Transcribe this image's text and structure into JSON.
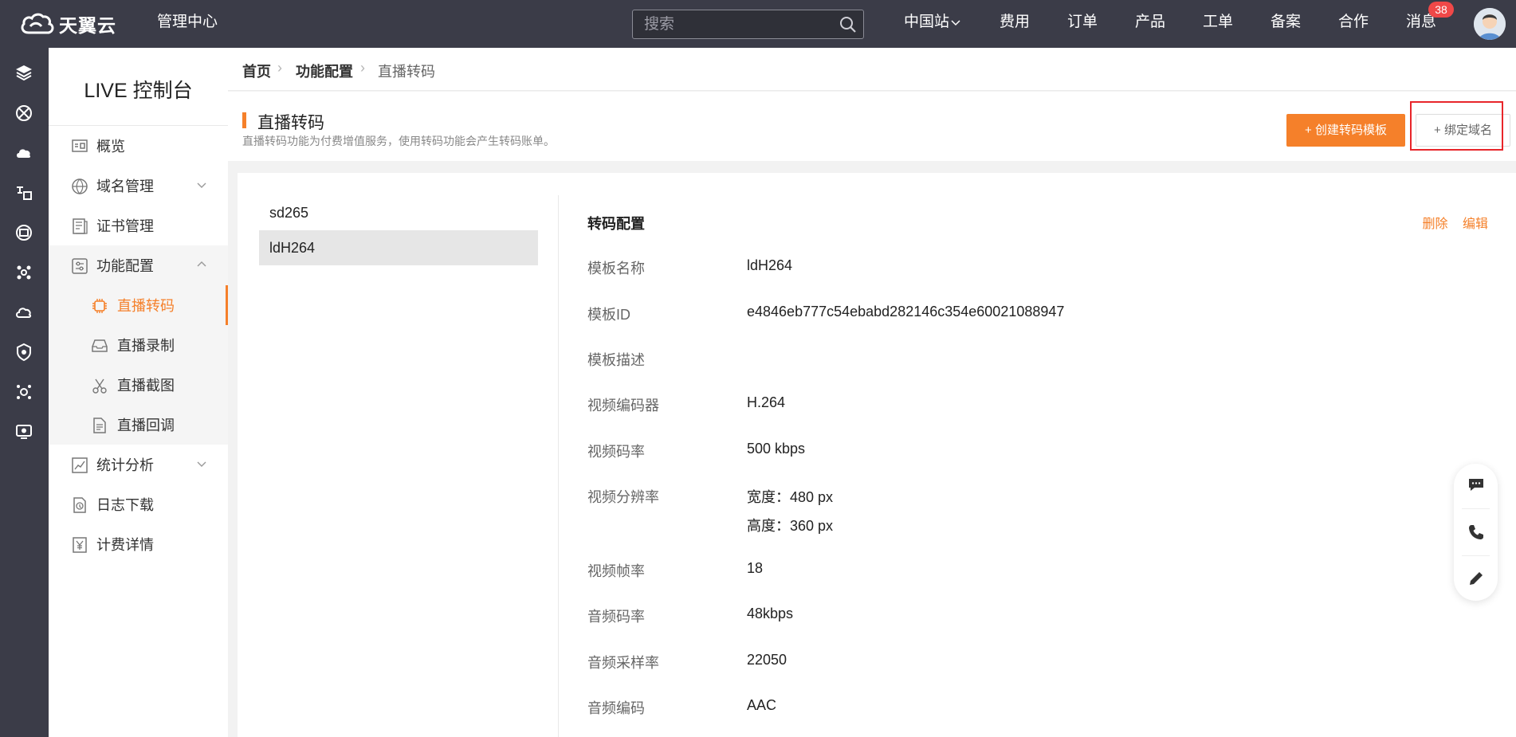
{
  "topbar": {
    "logo_text": "天翼云",
    "management_center": "管理中心",
    "search": {
      "placeholder": "搜索"
    },
    "nav": {
      "region": "中国站",
      "fees": "费用",
      "orders": "订单",
      "products": "产品",
      "tickets": "工单",
      "filing": "备案",
      "cooperation": "合作",
      "messages": "消息"
    },
    "message_count": "38"
  },
  "rail": {
    "icons": [
      "layers-icon",
      "grid-icon",
      "cloud-icon",
      "translate-icon",
      "window-icon",
      "network-icon",
      "cloud-sync-icon",
      "shield-icon",
      "cluster-icon",
      "monitor-icon"
    ]
  },
  "sidebar": {
    "title": "LIVE 控制台",
    "items": [
      {
        "label": "概览"
      },
      {
        "label": "域名管理"
      },
      {
        "label": "证书管理"
      },
      {
        "label": "功能配置"
      },
      {
        "label": "直播转码"
      },
      {
        "label": "直播录制"
      },
      {
        "label": "直播截图"
      },
      {
        "label": "直播回调"
      },
      {
        "label": "统计分析"
      },
      {
        "label": "日志下载"
      },
      {
        "label": "计费详情"
      }
    ]
  },
  "breadcrumb": {
    "home": "首页",
    "section": "功能配置",
    "current": "直播转码"
  },
  "header": {
    "title": "直播转码",
    "description": "直播转码功能为付费增值服务，使用转码功能会产生转码账单。",
    "create_button": "+ 创建转码模板",
    "bind_button": "+ 绑定域名"
  },
  "templates": {
    "items": [
      "sd265",
      "ldH264"
    ],
    "selected": "ldH264"
  },
  "detail": {
    "title": "转码配置",
    "delete": "删除",
    "edit": "编辑",
    "rows": [
      {
        "label": "模板名称",
        "value": "ldH264"
      },
      {
        "label": "模板ID",
        "value": "e4846eb777c54ebabd282146c354e60021088947"
      },
      {
        "label": "模板描述",
        "value": ""
      },
      {
        "label": "视频编码器",
        "value": "H.264"
      },
      {
        "label": "视频码率",
        "value": "500 kbps"
      },
      {
        "label": "视频分辨率",
        "value": "宽度：480 px",
        "value2": "高度：360 px"
      },
      {
        "label": "视频帧率",
        "value": "18"
      },
      {
        "label": "音频码率",
        "value": "48kbps"
      },
      {
        "label": "音频采样率",
        "value": "22050"
      },
      {
        "label": "音频编码",
        "value": "AAC"
      }
    ]
  },
  "colors": {
    "accent": "#f5802a",
    "topbar": "#3b3c48",
    "highlight": "#e8252a",
    "badge": "#f04848"
  }
}
